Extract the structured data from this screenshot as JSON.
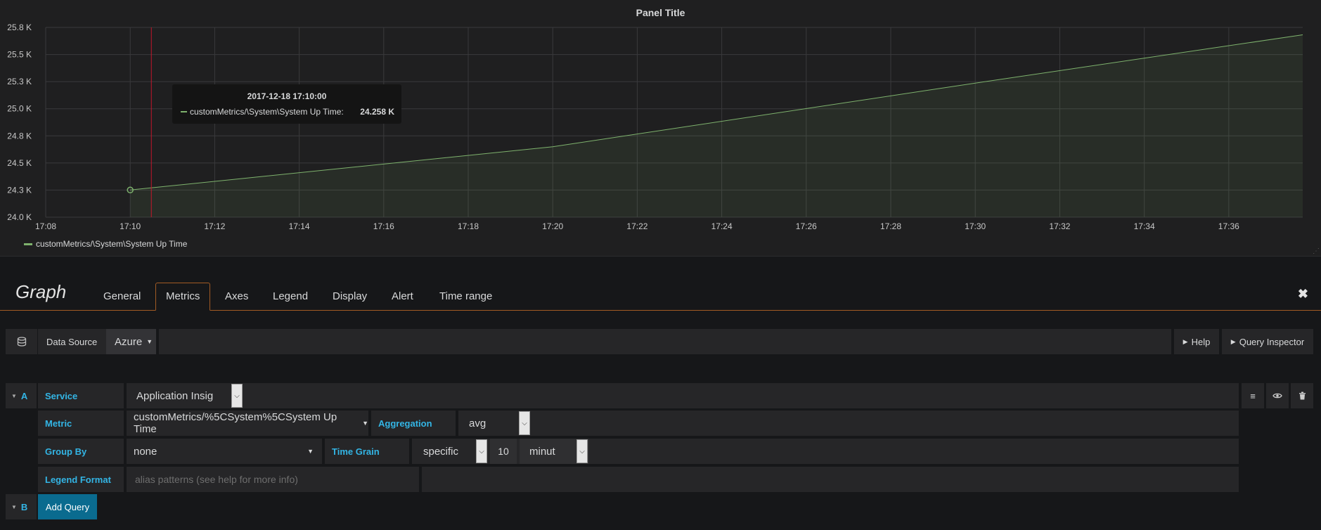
{
  "panel": {
    "title": "Panel Title",
    "tooltip": {
      "time": "2017-12-18 17:10:00",
      "series": "customMetrics/\\System\\System Up Time:",
      "value": "24.258 K"
    },
    "legend": "customMetrics/\\System\\System Up Time"
  },
  "chart_data": {
    "type": "area",
    "title": "Panel Title",
    "xlabel": "",
    "ylabel": "",
    "y_ticks": [
      "24.0 K",
      "24.3 K",
      "24.5 K",
      "24.8 K",
      "25.0 K",
      "25.3 K",
      "25.5 K",
      "25.8 K"
    ],
    "x_ticks": [
      "17:08",
      "17:10",
      "17:12",
      "17:14",
      "17:16",
      "17:18",
      "17:20",
      "17:22",
      "17:24",
      "17:26",
      "17:28",
      "17:30",
      "17:32",
      "17:34",
      "17:36"
    ],
    "ylim": [
      24000,
      25800
    ],
    "xlim_minutes": [
      "17:08",
      "17:37:45"
    ],
    "grid": true,
    "legend_position": "bottom-left",
    "series": [
      {
        "name": "customMetrics/\\System\\System Up Time",
        "color": "#7eb26d",
        "x": [
          "17:10",
          "17:20",
          "17:30",
          "17:37:45"
        ],
        "y": [
          24258,
          24668,
          25272,
          25730
        ]
      }
    ],
    "crosshair_x": "17:10:30"
  },
  "editor": {
    "title": "Graph",
    "tabs": [
      "General",
      "Metrics",
      "Axes",
      "Legend",
      "Display",
      "Alert",
      "Time range"
    ],
    "active_tab": "Metrics",
    "close_icon": "✖",
    "datasource_label": "Data Source",
    "datasource_value": "Azure",
    "help_label": "Help",
    "query_inspector_label": "Query Inspector",
    "query_a": {
      "ref": "A",
      "service_label": "Service",
      "service_value": "Application Insig",
      "metric_label": "Metric",
      "metric_value": "customMetrics/%5CSystem%5CSystem Up Time",
      "aggregation_label": "Aggregation",
      "aggregation_value": "avg",
      "groupby_label": "Group By",
      "groupby_value": "none",
      "timegrain_label": "Time Grain",
      "timegrain_mode": "specific",
      "timegrain_number": "10",
      "timegrain_unit": "minut",
      "legend_format_label": "Legend Format",
      "legend_format_placeholder": "alias patterns (see help for more info)"
    },
    "query_b": {
      "ref": "B",
      "add_query_label": "Add Query"
    }
  }
}
